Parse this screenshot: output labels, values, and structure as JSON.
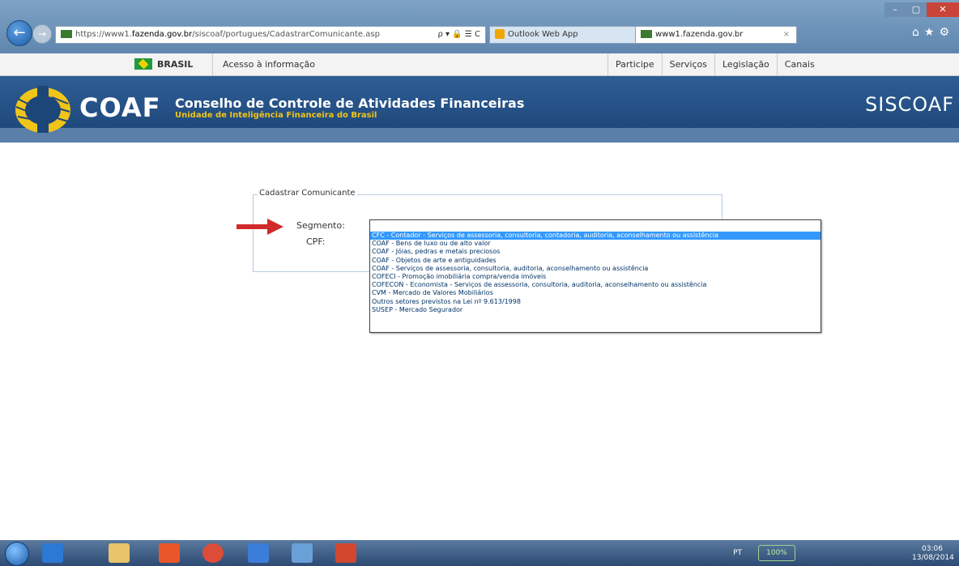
{
  "browser": {
    "url_prefix": "https://www1.",
    "url_host": "fazenda.gov.br",
    "url_path": "/siscoaf/portugues/CadastrarComunicante.asp",
    "url_controls": "ρ ▾ 🔒 ☰ C",
    "tabs": [
      {
        "label": "Outlook Web App"
      },
      {
        "label": "www1.fazenda.gov.br"
      }
    ],
    "tab_close": "×"
  },
  "govbar": {
    "brasil": "BRASIL",
    "acesso": "Acesso à informação",
    "nav": [
      "Participe",
      "Serviços",
      "Legislação",
      "Canais"
    ]
  },
  "header": {
    "logo": "COAF",
    "title": "Conselho de Controle de Atividades Financeiras",
    "subtitle": "Unidade de Inteligência Financeira do Brasil",
    "system": "SISCOAF"
  },
  "form": {
    "legend": "Cadastrar Comunicante",
    "segmento_label": "Segmento:",
    "cpf_label": "CPF:",
    "options": [
      "CFC - Contador - Serviços de assessoria, consultoria, contadoria, auditoria, aconselhamento ou assistência",
      "COAF - Bens de luxo ou de alto valor",
      "COAF - Jóias, pedras e metais preciosos",
      "COAF - Objetos de arte e antiguidades",
      "COAF - Serviços de assessoria, consultoria, auditoria, aconselhamento ou assistência",
      "COFECI - Promoção imobiliária compra/venda imóveis",
      "COFECON - Economista - Serviços de assessoria, consultoria, auditoria, aconselhamento ou assistência",
      "CVM - Mercado de Valores Mobiliários",
      "Outros setores previstos na Lei nº 9.613/1998",
      "SUSEP - Mercado Segurador"
    ],
    "selected_index": 0
  },
  "taskbar": {
    "lang": "PT",
    "battery": "100%",
    "time": "03:06",
    "date": "13/08/2014"
  }
}
